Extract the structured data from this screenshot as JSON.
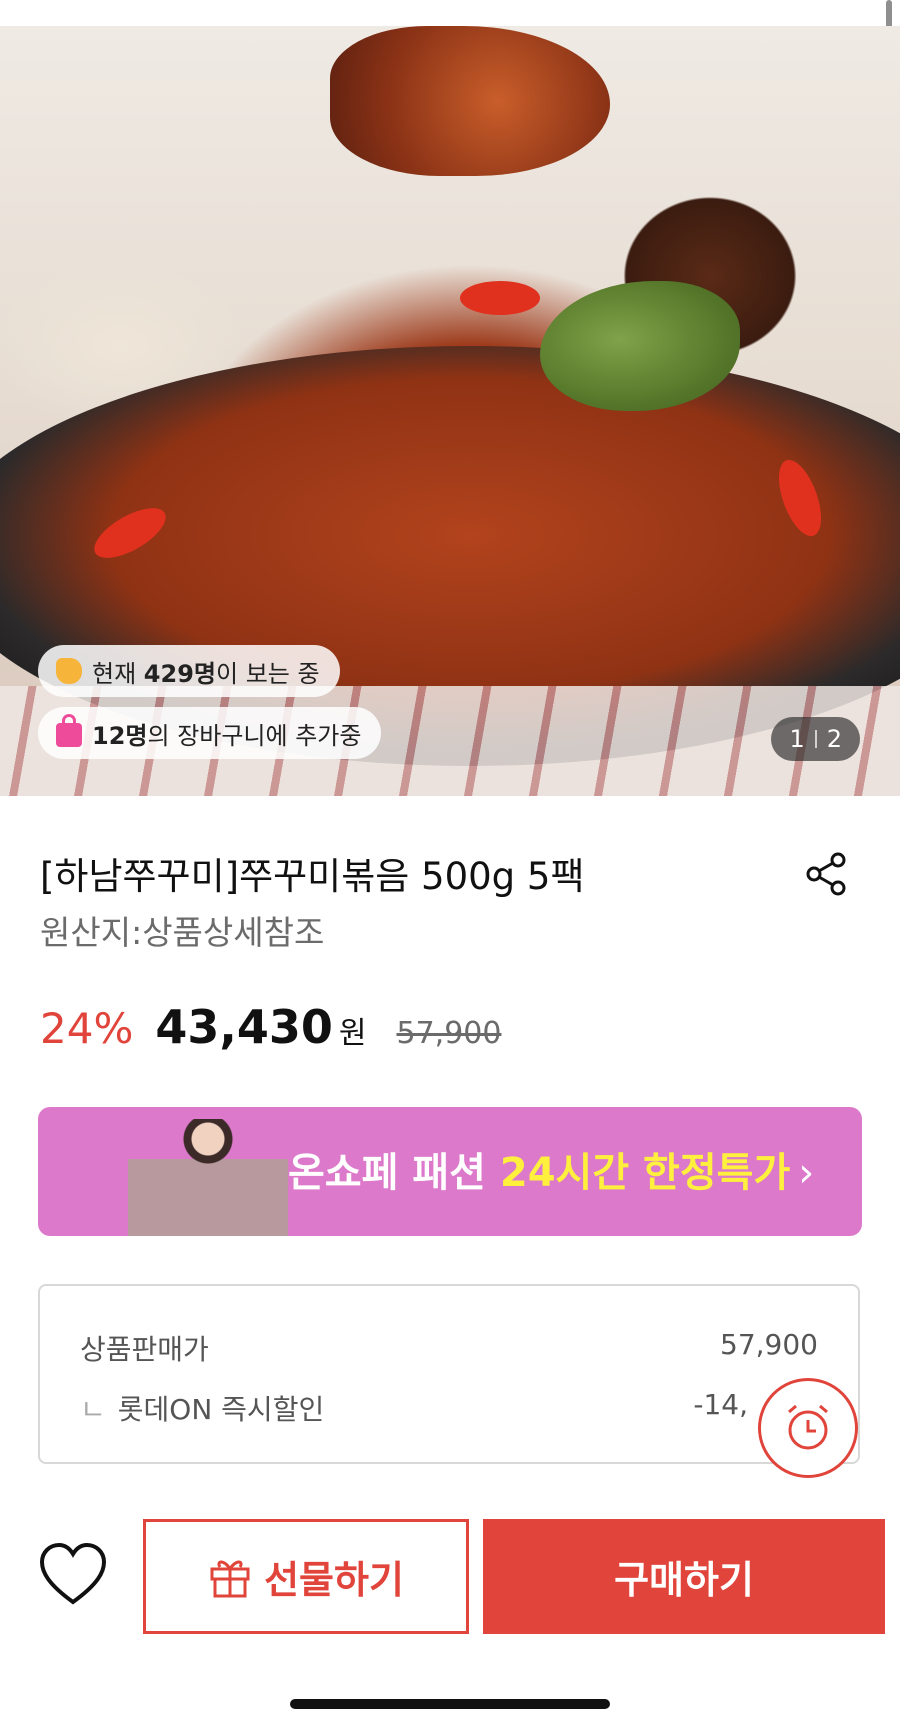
{
  "hero": {
    "viewers_prefix": "현재 ",
    "viewers_count": "429명",
    "viewers_suffix": "이 보는 중",
    "cart_count": "12명",
    "cart_suffix": "의 장바구니에 추가중",
    "image_index": "1",
    "image_total": "2"
  },
  "product": {
    "title": "[하남쭈꾸미]쭈꾸미볶음 500g 5팩",
    "origin": "원산지:상품상세참조",
    "discount": "24%",
    "price": "43,430",
    "currency": "원",
    "original_price": "57,900"
  },
  "banner": {
    "text_prefix": "온쇼페 패션 ",
    "text_highlight": "24시간 한정특가",
    "chevron": "›"
  },
  "price_box": {
    "rows": [
      {
        "label": "상품판매가",
        "value": "57,900"
      },
      {
        "label": "롯데ON 즉시할인",
        "value": "-14,",
        "prefix": "ㄴ"
      }
    ]
  },
  "actions": {
    "gift_label": "선물하기",
    "buy_label": "구매하기"
  },
  "colors": {
    "accent": "#e0443a",
    "banner_bg": "#dd79cb",
    "banner_highlight": "#fff03d"
  },
  "icons": [
    "hand-icon",
    "bag-icon",
    "share-icon",
    "alarm-clock-icon",
    "heart-icon",
    "gift-icon"
  ]
}
